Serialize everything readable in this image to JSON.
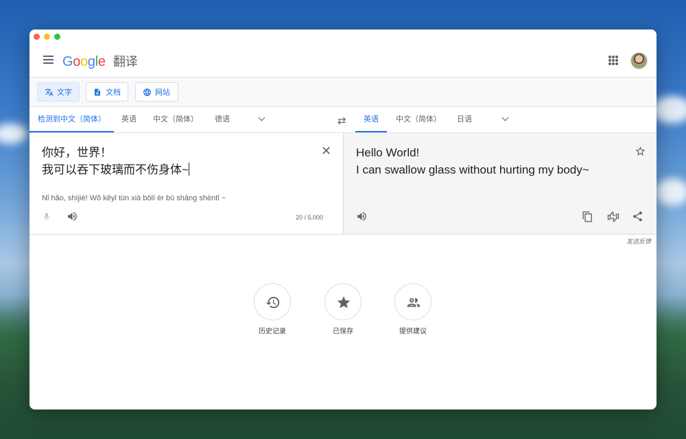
{
  "app": {
    "brand": "Google",
    "product": "翻译"
  },
  "modes": [
    {
      "label": "文字",
      "icon": "translate-icon",
      "active": true
    },
    {
      "label": "文档",
      "icon": "document-icon",
      "active": false
    },
    {
      "label": "网站",
      "icon": "globe-icon",
      "active": false
    }
  ],
  "source_langs": [
    "检测到中文（简体）",
    "英语",
    "中文（简体）",
    "德语"
  ],
  "target_langs": [
    "英语",
    "中文（简体）",
    "日语"
  ],
  "source": {
    "text": "你好，世界！\n我可以吞下玻璃而不伤身体~",
    "romanization": "Nǐ hǎo, shìjiè! Wǒ kěyǐ tūn xià bōlí ér bù shāng shēntǐ ~",
    "char_count": "20 / 5,000"
  },
  "target": {
    "text": "Hello World!\nI can swallow glass without hurting my body~"
  },
  "feedback_label": "发送反馈",
  "shortcuts": [
    {
      "label": "历史记录",
      "icon": "history-icon"
    },
    {
      "label": "已保存",
      "icon": "star-icon"
    },
    {
      "label": "提供建议",
      "icon": "people-icon"
    }
  ],
  "colors": {
    "accent": "#1a73e8",
    "target_bg": "#f5f5f5"
  }
}
